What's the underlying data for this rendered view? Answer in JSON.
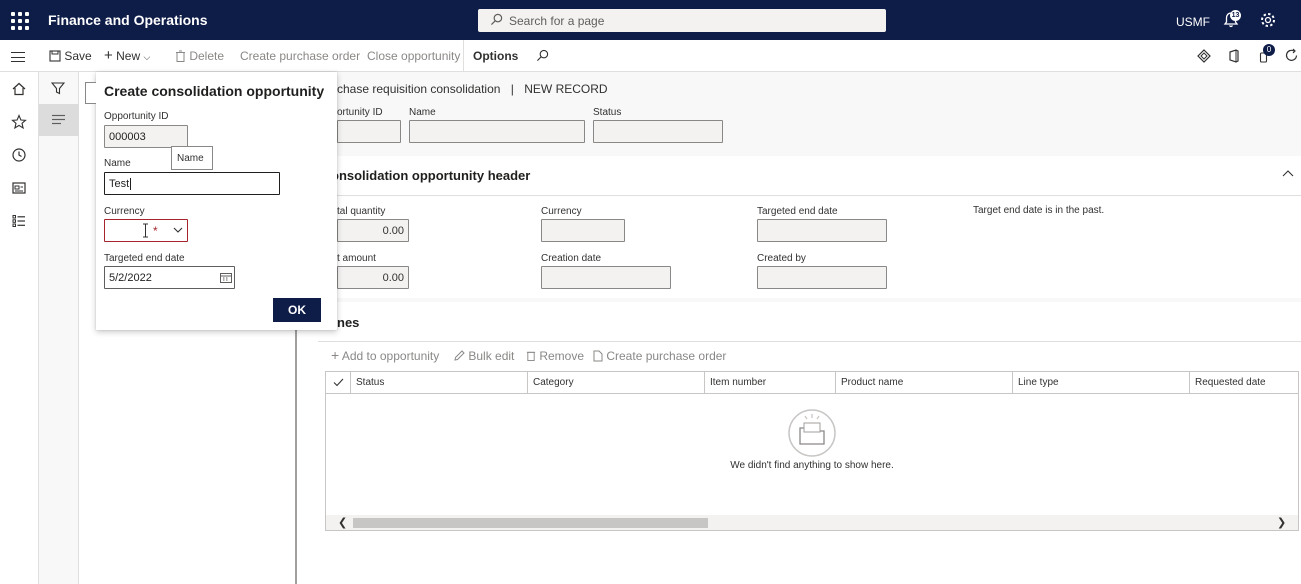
{
  "topbar": {
    "app_title": "Finance and Operations",
    "search_placeholder": "Search for a page",
    "company": "USMF",
    "notification_count": "13"
  },
  "actionbar": {
    "save": "Save",
    "new": "New",
    "delete": "Delete",
    "create_purchase_order": "Create purchase order",
    "close_opportunity": "Close opportunity",
    "options": "Options",
    "message_count": "0"
  },
  "form": {
    "breadcrumb_page": "chase requisition consolidation",
    "breadcrumb_sep": "|",
    "breadcrumb_record": "NEW RECORD",
    "top_fields": {
      "opportunity_id_label": "ortunity ID",
      "name_label": "Name",
      "status_label": "Status"
    },
    "header_section": {
      "title": "onsolidation opportunity header",
      "total_quantity_label": "tal quantity",
      "total_quantity_value": "0.00",
      "currency_label": "Currency",
      "targeted_end_date_label": "Targeted end date",
      "warning": "Target end date is in the past.",
      "amount_label": "t amount",
      "amount_value": "0.00",
      "creation_date_label": "Creation date",
      "created_by_label": "Created by"
    },
    "lines_section": {
      "title": "nes",
      "toolbar": {
        "add": "Add to opportunity",
        "bulk_edit": "Bulk edit",
        "remove": "Remove",
        "create_po": "Create purchase order"
      },
      "columns": [
        "Status",
        "Category",
        "Item number",
        "Product name",
        "Line type",
        "Requested date"
      ],
      "empty_message": "We didn't find anything to show here."
    }
  },
  "dialog": {
    "title": "Create consolidation opportunity",
    "opportunity_id_label": "Opportunity ID",
    "opportunity_id_value": "000003",
    "name_label": "Name",
    "name_value": "Test",
    "name_tooltip": "Name",
    "currency_label": "Currency",
    "currency_value": "",
    "required_marker": "*",
    "targeted_end_date_label": "Targeted end date",
    "targeted_end_date_value": "5/2/2022",
    "ok": "OK"
  },
  "colors": {
    "topbar_bg": "#0e1c48",
    "required": "#a4262c",
    "primary_button": "#0e1c48"
  }
}
